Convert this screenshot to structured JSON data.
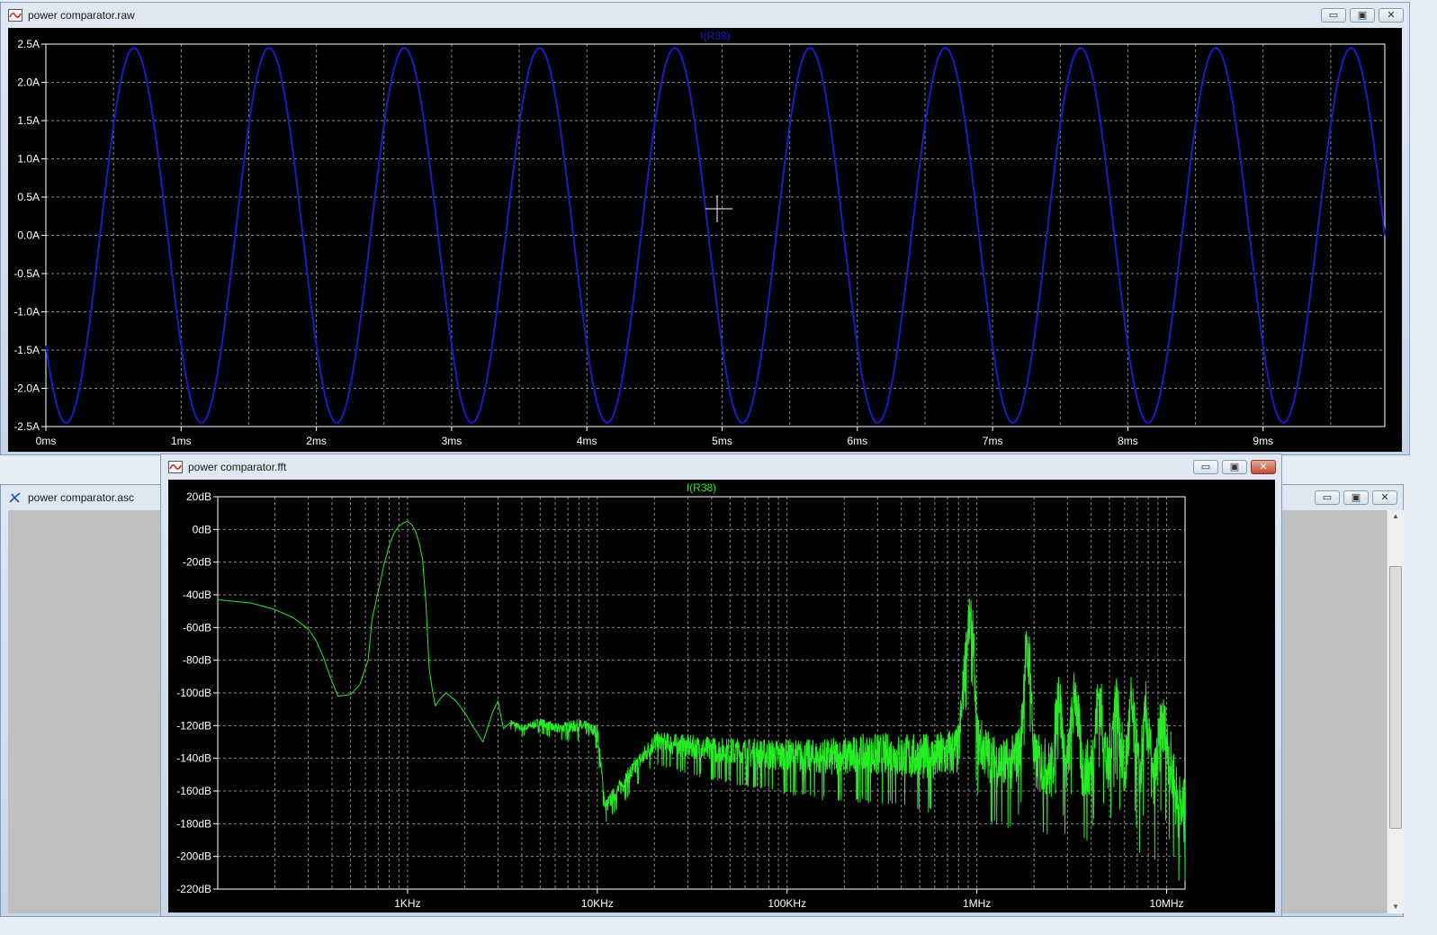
{
  "windows": {
    "raw": {
      "title": "power comparator.raw"
    },
    "fft": {
      "title": "power comparator.fft"
    },
    "asc": {
      "title": "power comparator.asc"
    }
  },
  "controls": {
    "minimize": "▭",
    "maximize": "▣",
    "close": "✕"
  },
  "icons": {
    "waveform_window": "waveform-icon",
    "schematic_window": "schematic-icon"
  },
  "colors": {
    "transient_trace": "#1a1acc",
    "fft_trace": "#22ee22",
    "axis_text": "#ffffff",
    "grid": "#8a8a8a",
    "plot_background": "#000000"
  },
  "chart_data": [
    {
      "type": "line",
      "title": "I(R38)",
      "title_color": "#1a1acc",
      "x_tick_labels": [
        "0ms",
        "1ms",
        "2ms",
        "3ms",
        "4ms",
        "5ms",
        "6ms",
        "7ms",
        "8ms",
        "9ms"
      ],
      "y_tick_labels": [
        "2.5A",
        "2.0A",
        "1.5A",
        "1.0A",
        "0.5A",
        "0.0A",
        "-0.5A",
        "-1.0A",
        "-1.5A",
        "-2.0A",
        "-2.5A"
      ],
      "xlim_ms": [
        0,
        9.9
      ],
      "ylim_A": [
        -2.5,
        2.5
      ],
      "grid": true,
      "series": [
        {
          "color": "#1a1acc",
          "waveform": "sine",
          "amplitude_A": 2.45,
          "period_ms": 1.0,
          "first_peak_ms": 0.65
        }
      ]
    },
    {
      "type": "line",
      "title": "I(R38)",
      "title_color": "#22ee22",
      "x_scale": "log",
      "x_tick_labels": [
        "1KHz",
        "10KHz",
        "100KHz",
        "1MHz",
        "10MHz"
      ],
      "x_tick_values_hz": [
        1000,
        10000,
        100000,
        1000000,
        10000000
      ],
      "y_tick_labels": [
        "20dB",
        "0dB",
        "-20dB",
        "-40dB",
        "-60dB",
        "-80dB",
        "-100dB",
        "-120dB",
        "-140dB",
        "-160dB",
        "-180dB",
        "-200dB",
        "-220dB"
      ],
      "xlim_hz": [
        100,
        12500000
      ],
      "ylim_db": [
        -220,
        20
      ],
      "grid": true,
      "series": [
        {
          "color": "#22ee22",
          "points": [
            [
              100,
              -43
            ],
            [
              150,
              -45
            ],
            [
              200,
              -49
            ],
            [
              250,
              -54
            ],
            [
              300,
              -61
            ],
            [
              330,
              -68
            ],
            [
              360,
              -78
            ],
            [
              380,
              -86
            ],
            [
              400,
              -93
            ],
            [
              430,
              -102
            ],
            [
              500,
              -101
            ],
            [
              560,
              -95
            ],
            [
              620,
              -80
            ],
            [
              650,
              -55
            ],
            [
              700,
              -38
            ],
            [
              750,
              -22
            ],
            [
              800,
              -10
            ],
            [
              850,
              -2
            ],
            [
              900,
              2
            ],
            [
              950,
              4
            ],
            [
              1000,
              5
            ],
            [
              1050,
              3
            ],
            [
              1100,
              -1
            ],
            [
              1150,
              -8
            ],
            [
              1200,
              -18
            ],
            [
              1250,
              -45
            ],
            [
              1300,
              -85
            ],
            [
              1350,
              -98
            ],
            [
              1400,
              -108
            ],
            [
              1500,
              -103
            ],
            [
              1600,
              -100
            ],
            [
              1800,
              -105
            ],
            [
              2000,
              -112
            ],
            [
              2200,
              -120
            ],
            [
              2500,
              -130
            ],
            [
              2800,
              -112
            ],
            [
              3000,
              -105
            ],
            [
              3200,
              -122
            ],
            [
              3500,
              -118
            ],
            [
              4000,
              -122
            ],
            [
              5000,
              -118
            ],
            [
              6000,
              -122
            ],
            [
              8000,
              -120
            ],
            [
              10000,
              -124
            ],
            [
              20000,
              -130
            ],
            [
              40000,
              -135
            ],
            [
              80000,
              -138
            ],
            [
              150000,
              -140
            ],
            [
              300000,
              -138
            ],
            [
              600000,
              -140
            ],
            [
              800000,
              -135
            ],
            [
              900000,
              -58
            ],
            [
              950000,
              -60
            ],
            [
              1000000,
              -128
            ],
            [
              1200000,
              -142
            ],
            [
              1500000,
              -145
            ],
            [
              1700000,
              -135
            ],
            [
              1800000,
              -78
            ],
            [
              1900000,
              -80
            ],
            [
              2000000,
              -142
            ],
            [
              2500000,
              -148
            ],
            [
              2700000,
              -95
            ],
            [
              2900000,
              -145
            ],
            [
              3000000,
              -145
            ],
            [
              3300000,
              -98
            ],
            [
              3600000,
              -148
            ],
            [
              4000000,
              -148
            ],
            [
              4400000,
              -100
            ],
            [
              4900000,
              -150
            ],
            [
              5400000,
              -104
            ],
            [
              6000000,
              -152
            ],
            [
              6500000,
              -108
            ],
            [
              7200000,
              -155
            ],
            [
              7800000,
              -112
            ],
            [
              8500000,
              -160
            ],
            [
              9500000,
              -118
            ],
            [
              11000,
              -170
            ],
            [
              11500000,
              -170
            ],
            [
              12500000,
              -175
            ]
          ],
          "noise_floor_note": null
        }
      ]
    }
  ]
}
